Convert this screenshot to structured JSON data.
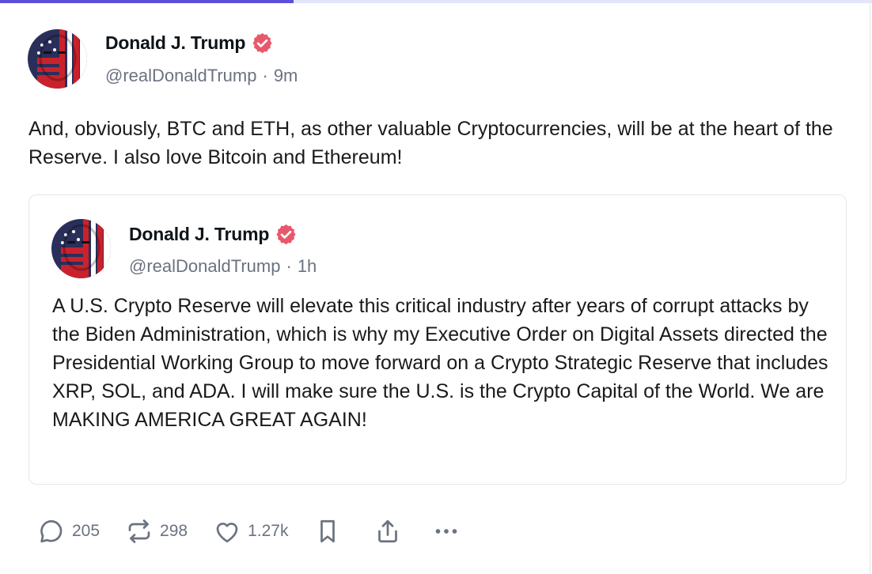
{
  "post": {
    "author": {
      "display_name": "Donald J. Trump",
      "handle": "@realDonaldTrump",
      "timestamp": "9m",
      "separator": "·",
      "verified_icon": "verified-badge-icon"
    },
    "text": "And, obviously, BTC and ETH, as other valuable Cryptocurrencies, will be at the heart of the Reserve. I also love Bitcoin and Ethereum!",
    "quote": {
      "author": {
        "display_name": "Donald J. Trump",
        "handle": "@realDonaldTrump",
        "timestamp": "1h",
        "separator": "·"
      },
      "text": "A U.S. Crypto Reserve will elevate this critical industry after years of corrupt attacks by the Biden Administration, which is why my Executive Order on Digital Assets directed the Presidential Working Group to move forward on a Crypto Strategic Reserve that includes XRP, SOL, and ADA. I will make sure the U.S. is the Crypto Capital of the World. We are MAKING AMERICA GREAT AGAIN!"
    },
    "actions": {
      "replies": "205",
      "reposts": "298",
      "likes": "1.27k",
      "icons": [
        "reply-icon",
        "repost-icon",
        "like-icon",
        "bookmark-icon",
        "share-icon",
        "more-icon"
      ]
    }
  },
  "colors": {
    "accent_bar": "#5b4fd6",
    "verified": "#e8586b",
    "muted_text": "#6b7280",
    "icon": "#6b7280"
  }
}
